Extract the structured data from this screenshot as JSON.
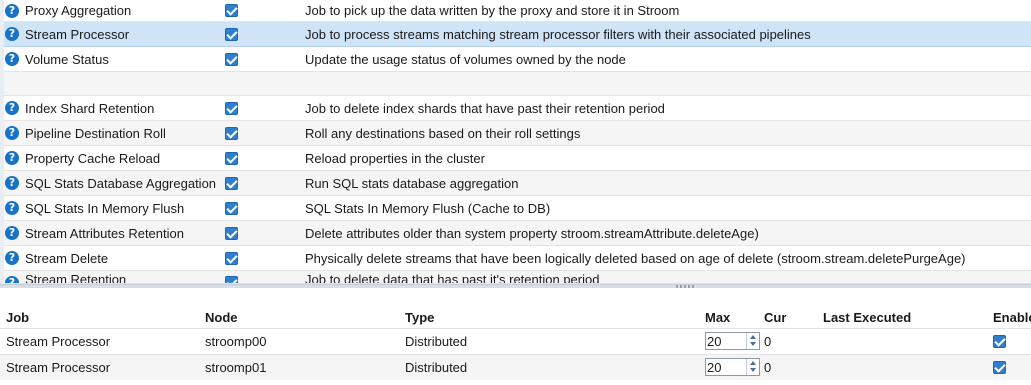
{
  "jobs": [
    {
      "name": "Proxy Aggregation",
      "enabled": true,
      "description": "Job to pick up the data written by the proxy and store it in Stroom"
    },
    {
      "name": "Stream Processor",
      "enabled": true,
      "description": "Job to process streams matching stream processor filters with their associated pipelines",
      "selected": true
    },
    {
      "name": "Volume Status",
      "enabled": true,
      "description": "Update the usage status of volumes owned by the node"
    },
    {
      "name": "Index Shard Retention",
      "enabled": true,
      "description": "Job to delete index shards that have past their retention period"
    },
    {
      "name": "Pipeline Destination Roll",
      "enabled": true,
      "description": "Roll any destinations based on their roll settings"
    },
    {
      "name": "Property Cache Reload",
      "enabled": true,
      "description": "Reload properties in the cluster"
    },
    {
      "name": "SQL Stats Database Aggregation",
      "enabled": true,
      "description": "Run SQL stats database aggregation"
    },
    {
      "name": "SQL Stats In Memory Flush",
      "enabled": true,
      "description": "SQL Stats In Memory Flush (Cache to DB)"
    },
    {
      "name": "Stream Attributes Retention",
      "enabled": true,
      "description": "Delete attributes older than system property stroom.streamAttribute.deleteAge)"
    },
    {
      "name": "Stream Delete",
      "enabled": true,
      "description": "Physically delete streams that have been logically deleted based on age of delete (stroom.stream.deletePurgeAge)"
    },
    {
      "name": "Stream Retention",
      "enabled": true,
      "description": "Job to delete data that has past it's retention period"
    }
  ],
  "nodes_table": {
    "columns": {
      "job": "Job",
      "node": "Node",
      "type": "Type",
      "max": "Max",
      "cur": "Cur",
      "last_executed": "Last Executed",
      "enabled": "Enable"
    },
    "rows": [
      {
        "job": "Stream Processor",
        "node": "stroomp00",
        "type": "Distributed",
        "max": "20",
        "cur": "0",
        "last_executed": "",
        "enabled": true
      },
      {
        "job": "Stream Processor",
        "node": "stroomp01",
        "type": "Distributed",
        "max": "20",
        "cur": "0",
        "last_executed": "",
        "enabled": true
      }
    ]
  },
  "icons": {
    "help": "help-icon",
    "checkbox": "checkbox-icon",
    "stepper": "spinner-arrows-icon",
    "splitter": "splitter-grip-icon"
  },
  "help_glyph": "?",
  "colors": {
    "selected_row": "#cfe4f7",
    "checkbox": "#2f7fd1",
    "help_icon": "#1673c7"
  }
}
